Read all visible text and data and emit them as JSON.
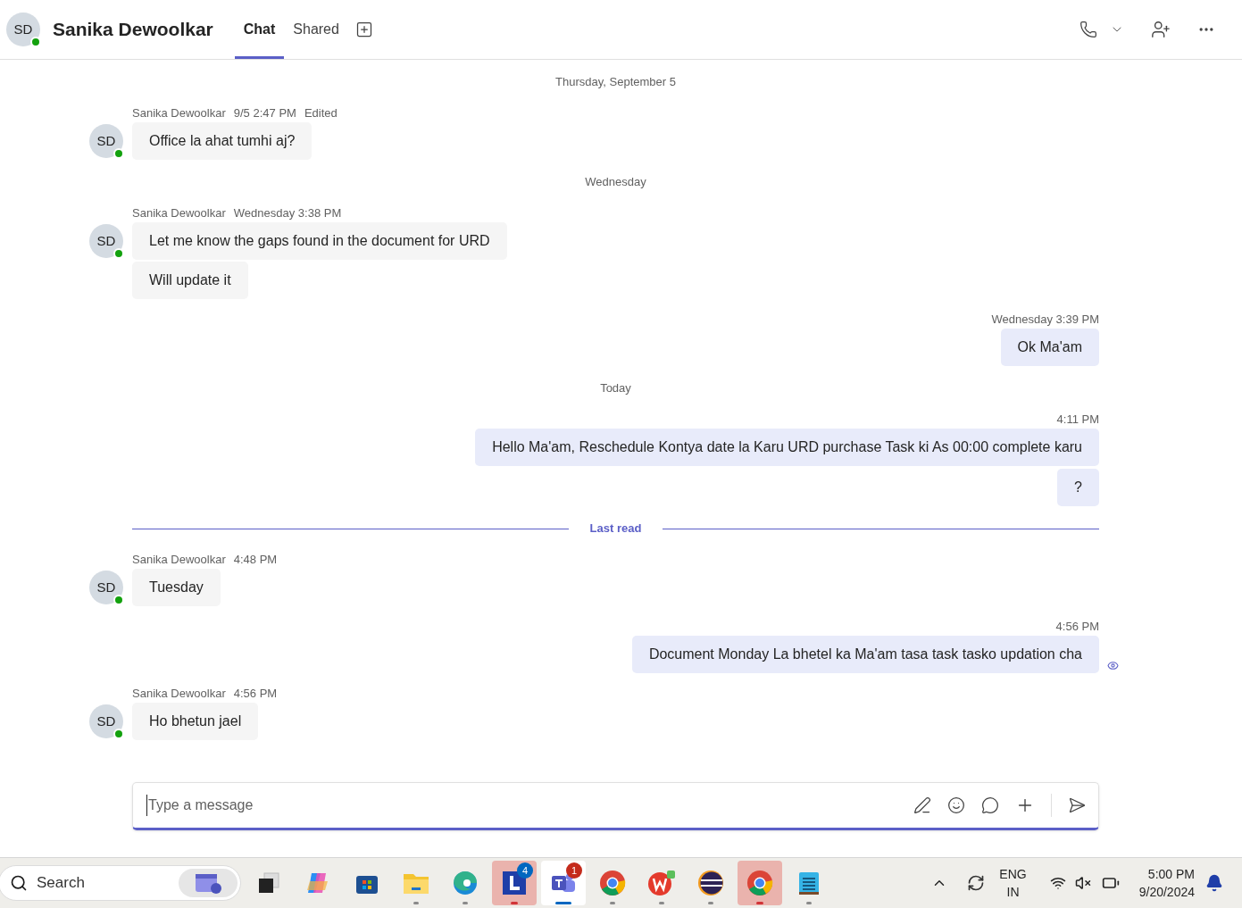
{
  "header": {
    "avatar": {
      "initials": "SD",
      "online": true
    },
    "name": "Sanika Dewoolkar",
    "tabs": [
      {
        "label": "Chat",
        "selected": true
      },
      {
        "label": "Shared",
        "selected": false
      }
    ]
  },
  "messages": [
    {
      "kind": "date",
      "label": "Thursday, September 5"
    },
    {
      "kind": "incoming",
      "sender": "Sanika Dewoolkar",
      "time": "9/5 2:47 PM",
      "note": "Edited",
      "avatar": {
        "initials": "SD",
        "online": true
      },
      "bubbles": [
        "Office la ahat tumhi aj?"
      ]
    },
    {
      "kind": "date",
      "label": "Wednesday"
    },
    {
      "kind": "incoming",
      "sender": "Sanika Dewoolkar",
      "time": "Wednesday 3:38 PM",
      "avatar": {
        "initials": "SD",
        "online": true
      },
      "bubbles": [
        "Let me know the gaps found in the document for URD",
        "Will update it"
      ]
    },
    {
      "kind": "outgoing",
      "time": "Wednesday 3:39 PM",
      "seen": false,
      "bubbles": [
        "Ok Ma'am"
      ]
    },
    {
      "kind": "date",
      "label": "Today"
    },
    {
      "kind": "outgoing",
      "time": "4:11 PM",
      "seen": false,
      "bubbles": [
        "Hello Ma'am, Reschedule Kontya date la Karu URD purchase Task ki As 00:00 complete karu",
        "?"
      ]
    },
    {
      "kind": "last_read",
      "label": "Last read"
    },
    {
      "kind": "incoming",
      "sender": "Sanika Dewoolkar",
      "time": "4:48 PM",
      "avatar": {
        "initials": "SD",
        "online": true
      },
      "bubbles": [
        "Tuesday"
      ]
    },
    {
      "kind": "outgoing",
      "time": "4:56 PM",
      "seen": true,
      "bubbles": [
        "Document Monday La bhetel ka Ma'am tasa task tasko updation cha"
      ]
    },
    {
      "kind": "incoming",
      "sender": "Sanika Dewoolkar",
      "time": "4:56 PM",
      "avatar": {
        "initials": "SD",
        "online": true
      },
      "bubbles": [
        "Ho bhetun jael"
      ]
    }
  ],
  "composer": {
    "placeholder": "Type a message"
  },
  "taskbar": {
    "search_placeholder": "Search",
    "apps": [
      {
        "kind": "taskview",
        "running": false,
        "focused": false,
        "flashing": false
      },
      {
        "kind": "copilot",
        "running": false,
        "focused": false,
        "flashing": false
      },
      {
        "kind": "store",
        "running": false,
        "focused": false,
        "flashing": false
      },
      {
        "kind": "files",
        "running": true,
        "focused": false,
        "flashing": false
      },
      {
        "kind": "edge",
        "running": true,
        "focused": false,
        "flashing": false
      },
      {
        "kind": "lapp",
        "running": true,
        "focused": false,
        "flashing": true,
        "badge": "4"
      },
      {
        "kind": "teams",
        "running": true,
        "focused": true,
        "flashing": false,
        "badge": "1"
      },
      {
        "kind": "chrome",
        "running": true,
        "focused": false,
        "flashing": false
      },
      {
        "kind": "wps",
        "running": true,
        "focused": false,
        "flashing": false
      },
      {
        "kind": "eclipse",
        "running": true,
        "focused": false,
        "flashing": false
      },
      {
        "kind": "chrome",
        "running": true,
        "focused": false,
        "flashing": true
      },
      {
        "kind": "notepad",
        "running": true,
        "focused": false,
        "flashing": false
      }
    ],
    "language": [
      "ENG",
      "IN"
    ],
    "time": "5:00 PM",
    "date": "9/20/2024"
  }
}
